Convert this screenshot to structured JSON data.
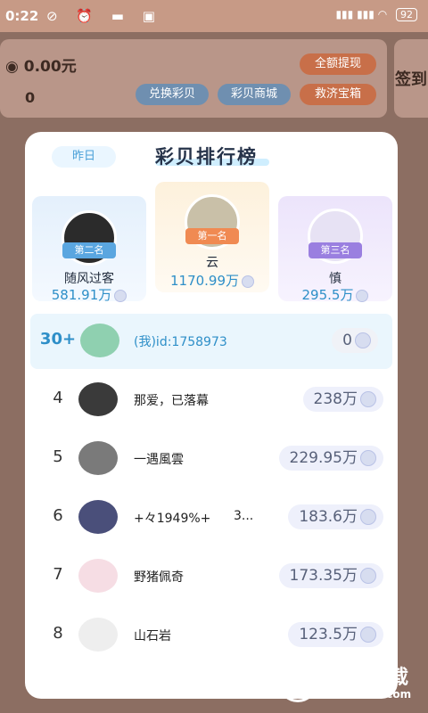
{
  "status_bar": {
    "time": "0:22",
    "signal": "HD",
    "battery": "92"
  },
  "background": {
    "coins_value": "0.00元",
    "beans_value": "0",
    "withdraw_all": "全额提现",
    "exchange": "兑换彩贝",
    "shop": "彩贝商城",
    "rescue": "救济宝箱",
    "sign_in": "签到"
  },
  "modal": {
    "tab_yesterday": "昨日",
    "title": "彩贝排行榜",
    "podium": [
      {
        "badge": "第二名",
        "name": "随风过客",
        "score": "581.91万",
        "color": "#5aa6e0"
      },
      {
        "badge": "第一名",
        "name": "云",
        "score": "1170.99万",
        "color": "#f08a52"
      },
      {
        "badge": "第三名",
        "name": "慎",
        "score": "295.5万",
        "color": "#9a7fe0"
      }
    ],
    "me": {
      "rank": "30+",
      "name": "(我)id:1758973",
      "score": "0"
    },
    "rows": [
      {
        "rank": "4",
        "name": "那爱，已落幕",
        "score": "238万"
      },
      {
        "rank": "5",
        "name": "一遇風雲",
        "score": "229.95万"
      },
      {
        "rank": "6",
        "name": "+々1949%+",
        "extra": "3...",
        "score": "183.6万"
      },
      {
        "rank": "7",
        "name": "野猪佩奇",
        "score": "173.35万"
      },
      {
        "rank": "8",
        "name": "山石岩",
        "score": "123.5万"
      }
    ]
  },
  "watermark": {
    "brand": "飞翔下载",
    "url": "www.fxxz.com"
  },
  "colors": {
    "accent_blue": "#2e8fc8",
    "rank_gold": "#f08a52"
  }
}
